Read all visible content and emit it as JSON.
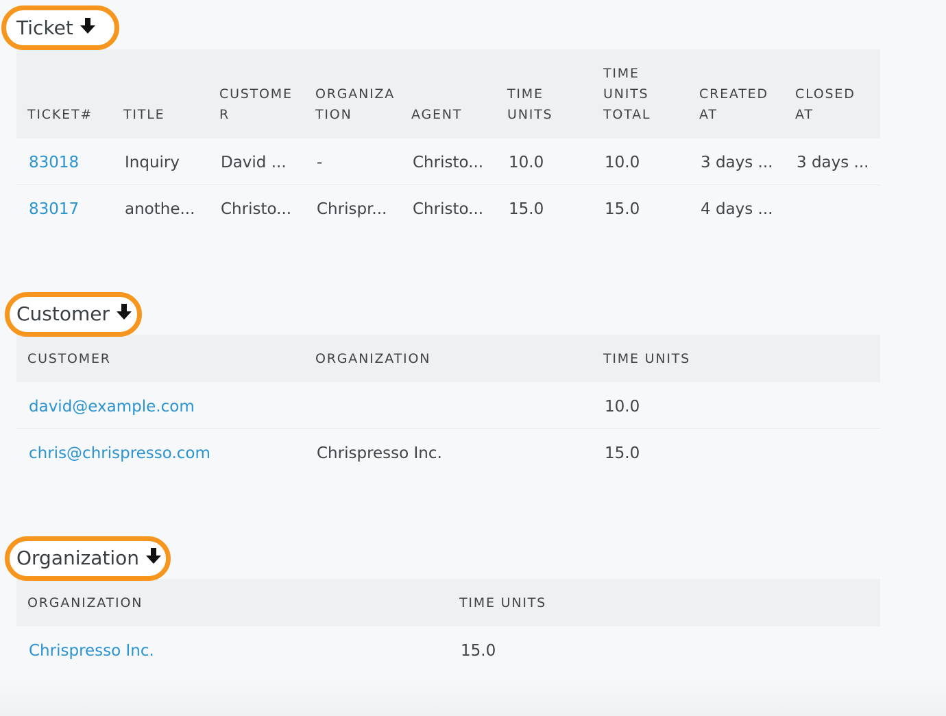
{
  "ticket_section": {
    "title": "Ticket",
    "columns": [
      [
        "TICKET#"
      ],
      [
        "TITLE"
      ],
      [
        "CUSTOME",
        "R"
      ],
      [
        "ORGANIZA",
        "TION"
      ],
      [
        "AGENT"
      ],
      [
        "TIME",
        "UNITS"
      ],
      [
        "TIME",
        "UNITS",
        "TOTAL"
      ],
      [
        "CREATED",
        "AT"
      ],
      [
        "CLOSED",
        "AT"
      ]
    ],
    "rows": [
      {
        "number": "83018",
        "title": "Inquiry",
        "customer": "David ...",
        "organization": "-",
        "agent": "Christo...",
        "time_units": "10.0",
        "time_units_total": "10.0",
        "created_at": "3 days ...",
        "closed_at": "3 days ..."
      },
      {
        "number": "83017",
        "title": "anothe...",
        "customer": "Christo...",
        "organization": "Chrispr...",
        "agent": "Christo...",
        "time_units": "15.0",
        "time_units_total": "15.0",
        "created_at": "4 days ...",
        "closed_at": ""
      }
    ]
  },
  "customer_section": {
    "title": "Customer",
    "columns": [
      "CUSTOMER",
      "ORGANIZATION",
      "TIME UNITS"
    ],
    "rows": [
      {
        "customer": "david@example.com",
        "organization": "",
        "time_units": "10.0"
      },
      {
        "customer": "chris@chrispresso.com",
        "organization": "Chrispresso Inc.",
        "time_units": "15.0"
      }
    ]
  },
  "organization_section": {
    "title": "Organization",
    "columns": [
      "ORGANIZATION",
      "TIME UNITS"
    ],
    "rows": [
      {
        "organization": "Chrispresso Inc.",
        "time_units": "15.0"
      }
    ]
  },
  "colors": {
    "highlight": "#f7961e",
    "link": "#2a93d0",
    "header_bg": "#eff0f2",
    "page_bg": "#f7f8fa"
  },
  "icons": {
    "section_toggle": "arrow-down-icon"
  }
}
